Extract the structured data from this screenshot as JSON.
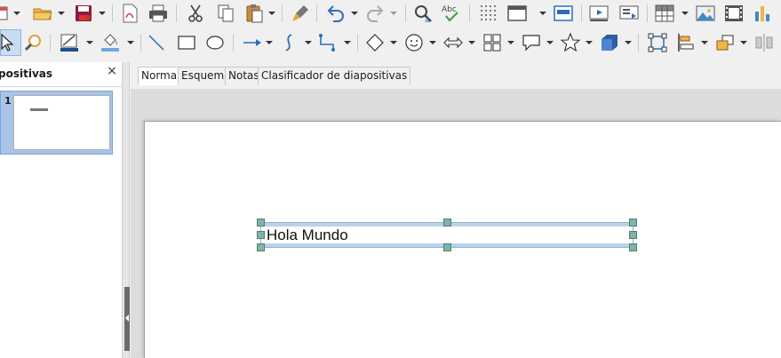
{
  "toolbar_standard": {
    "items": [
      {
        "icon": "presentation-icon",
        "has_dropdown": true
      },
      {
        "icon": "open-folder-icon",
        "has_dropdown": true
      },
      {
        "icon": "save-icon",
        "has_dropdown": true
      },
      {
        "icon": "export-pdf-icon",
        "has_dropdown": false
      },
      {
        "icon": "print-icon",
        "has_dropdown": false
      },
      {
        "icon": "cut-icon",
        "has_dropdown": false
      },
      {
        "icon": "copy-icon",
        "has_dropdown": false
      },
      {
        "icon": "paste-icon",
        "has_dropdown": true
      },
      {
        "icon": "clone-formatting-icon",
        "has_dropdown": false
      },
      {
        "icon": "undo-icon",
        "has_dropdown": true
      },
      {
        "icon": "redo-icon",
        "has_dropdown": true
      },
      {
        "icon": "find-replace-icon",
        "has_dropdown": false
      },
      {
        "icon": "spellcheck-icon",
        "has_dropdown": false
      },
      {
        "icon": "grid-display-icon",
        "has_dropdown": false
      },
      {
        "icon": "slide-layout-icon",
        "has_dropdown": true
      },
      {
        "icon": "master-slide-icon",
        "has_dropdown": false
      },
      {
        "icon": "slide-show-icon",
        "has_dropdown": false
      },
      {
        "icon": "slide-show-current-icon",
        "has_dropdown": false
      },
      {
        "icon": "table-icon",
        "has_dropdown": true
      },
      {
        "icon": "image-icon",
        "has_dropdown": false
      },
      {
        "icon": "media-icon",
        "has_dropdown": false
      },
      {
        "icon": "chart-icon",
        "has_dropdown": false
      }
    ]
  },
  "toolbar_drawing": {
    "items": [
      {
        "icon": "select-arrow-icon",
        "has_dropdown": false
      },
      {
        "icon": "zoom-pan-icon",
        "has_dropdown": false
      },
      {
        "icon": "line-color-icon",
        "has_dropdown": true
      },
      {
        "icon": "fill-color-icon",
        "has_dropdown": true
      },
      {
        "icon": "line-icon",
        "has_dropdown": false
      },
      {
        "icon": "rectangle-icon",
        "has_dropdown": false
      },
      {
        "icon": "ellipse-icon",
        "has_dropdown": false
      },
      {
        "icon": "arrow-line-icon",
        "has_dropdown": true
      },
      {
        "icon": "curve-icon",
        "has_dropdown": true
      },
      {
        "icon": "connector-icon",
        "has_dropdown": true
      },
      {
        "icon": "basic-shapes-icon",
        "has_dropdown": true
      },
      {
        "icon": "symbol-shapes-icon",
        "has_dropdown": true
      },
      {
        "icon": "block-arrows-icon",
        "has_dropdown": true
      },
      {
        "icon": "flowchart-icon",
        "has_dropdown": true
      },
      {
        "icon": "callout-icon",
        "has_dropdown": true
      },
      {
        "icon": "stars-icon",
        "has_dropdown": true
      },
      {
        "icon": "3d-objects-icon",
        "has_dropdown": true
      },
      {
        "icon": "points-icon",
        "has_dropdown": false
      },
      {
        "icon": "align-objects-icon",
        "has_dropdown": true
      },
      {
        "icon": "arrange-icon",
        "has_dropdown": true
      },
      {
        "icon": "distribute-icon",
        "has_dropdown": false
      }
    ]
  },
  "slides_panel": {
    "title": "positivas",
    "close_label": "×",
    "slides": [
      {
        "number": "1",
        "thumbnail_text": "Hola Mundo"
      }
    ]
  },
  "view_tabs": [
    {
      "label": "Normal",
      "active": true
    },
    {
      "label": "Esquema",
      "active": false
    },
    {
      "label": "Notas",
      "active": false
    },
    {
      "label": "Clasificador de diapositivas",
      "active": false
    }
  ],
  "slide": {
    "textbox_text": "Hola Mundo"
  },
  "colors": {
    "accent_blue": "#2a6ebb",
    "selection_band": "#bcd2ea",
    "handle_fill": "#7fb3a4",
    "save_red": "#b0263a"
  }
}
